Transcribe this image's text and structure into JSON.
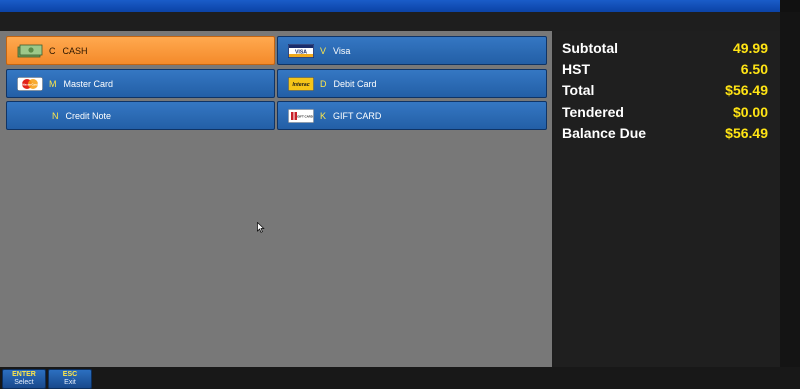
{
  "payment_methods": [
    {
      "hotkey": "C",
      "label": "CASH",
      "icon": "cash-icon",
      "selected": true
    },
    {
      "hotkey": "V",
      "label": "Visa",
      "icon": "visa-icon",
      "icon_text": "VISA"
    },
    {
      "hotkey": "M",
      "label": "Master Card",
      "icon": "mastercard-icon",
      "icon_text": "MasterCard"
    },
    {
      "hotkey": "D",
      "label": "Debit Card",
      "icon": "interac-icon",
      "icon_text": "Interac"
    },
    {
      "hotkey": "N",
      "label": "Credit Note"
    },
    {
      "hotkey": "K",
      "label": "GIFT CARD",
      "icon": "gift-card-icon",
      "icon_text": "GIFT CARD"
    }
  ],
  "summary": {
    "subtotal": {
      "label": "Subtotal",
      "value": "49.99"
    },
    "tax": {
      "label": "HST",
      "value": "6.50"
    },
    "total": {
      "label": "Total",
      "value": "$56.49"
    },
    "tendered": {
      "label": "Tendered",
      "value": "$0.00"
    },
    "balance_due": {
      "label": "Balance Due",
      "value": "$56.49"
    }
  },
  "function_keys": [
    {
      "key": "ENTER",
      "label": "Select"
    },
    {
      "key": "ESC",
      "label": "Exit"
    }
  ],
  "colors": {
    "tile_blue": "#2a67b0",
    "tile_selected": "#f9963a",
    "hotkey_yellow": "#ffe84a",
    "amount_yellow": "#ffe414",
    "panel_gray": "#787878"
  }
}
